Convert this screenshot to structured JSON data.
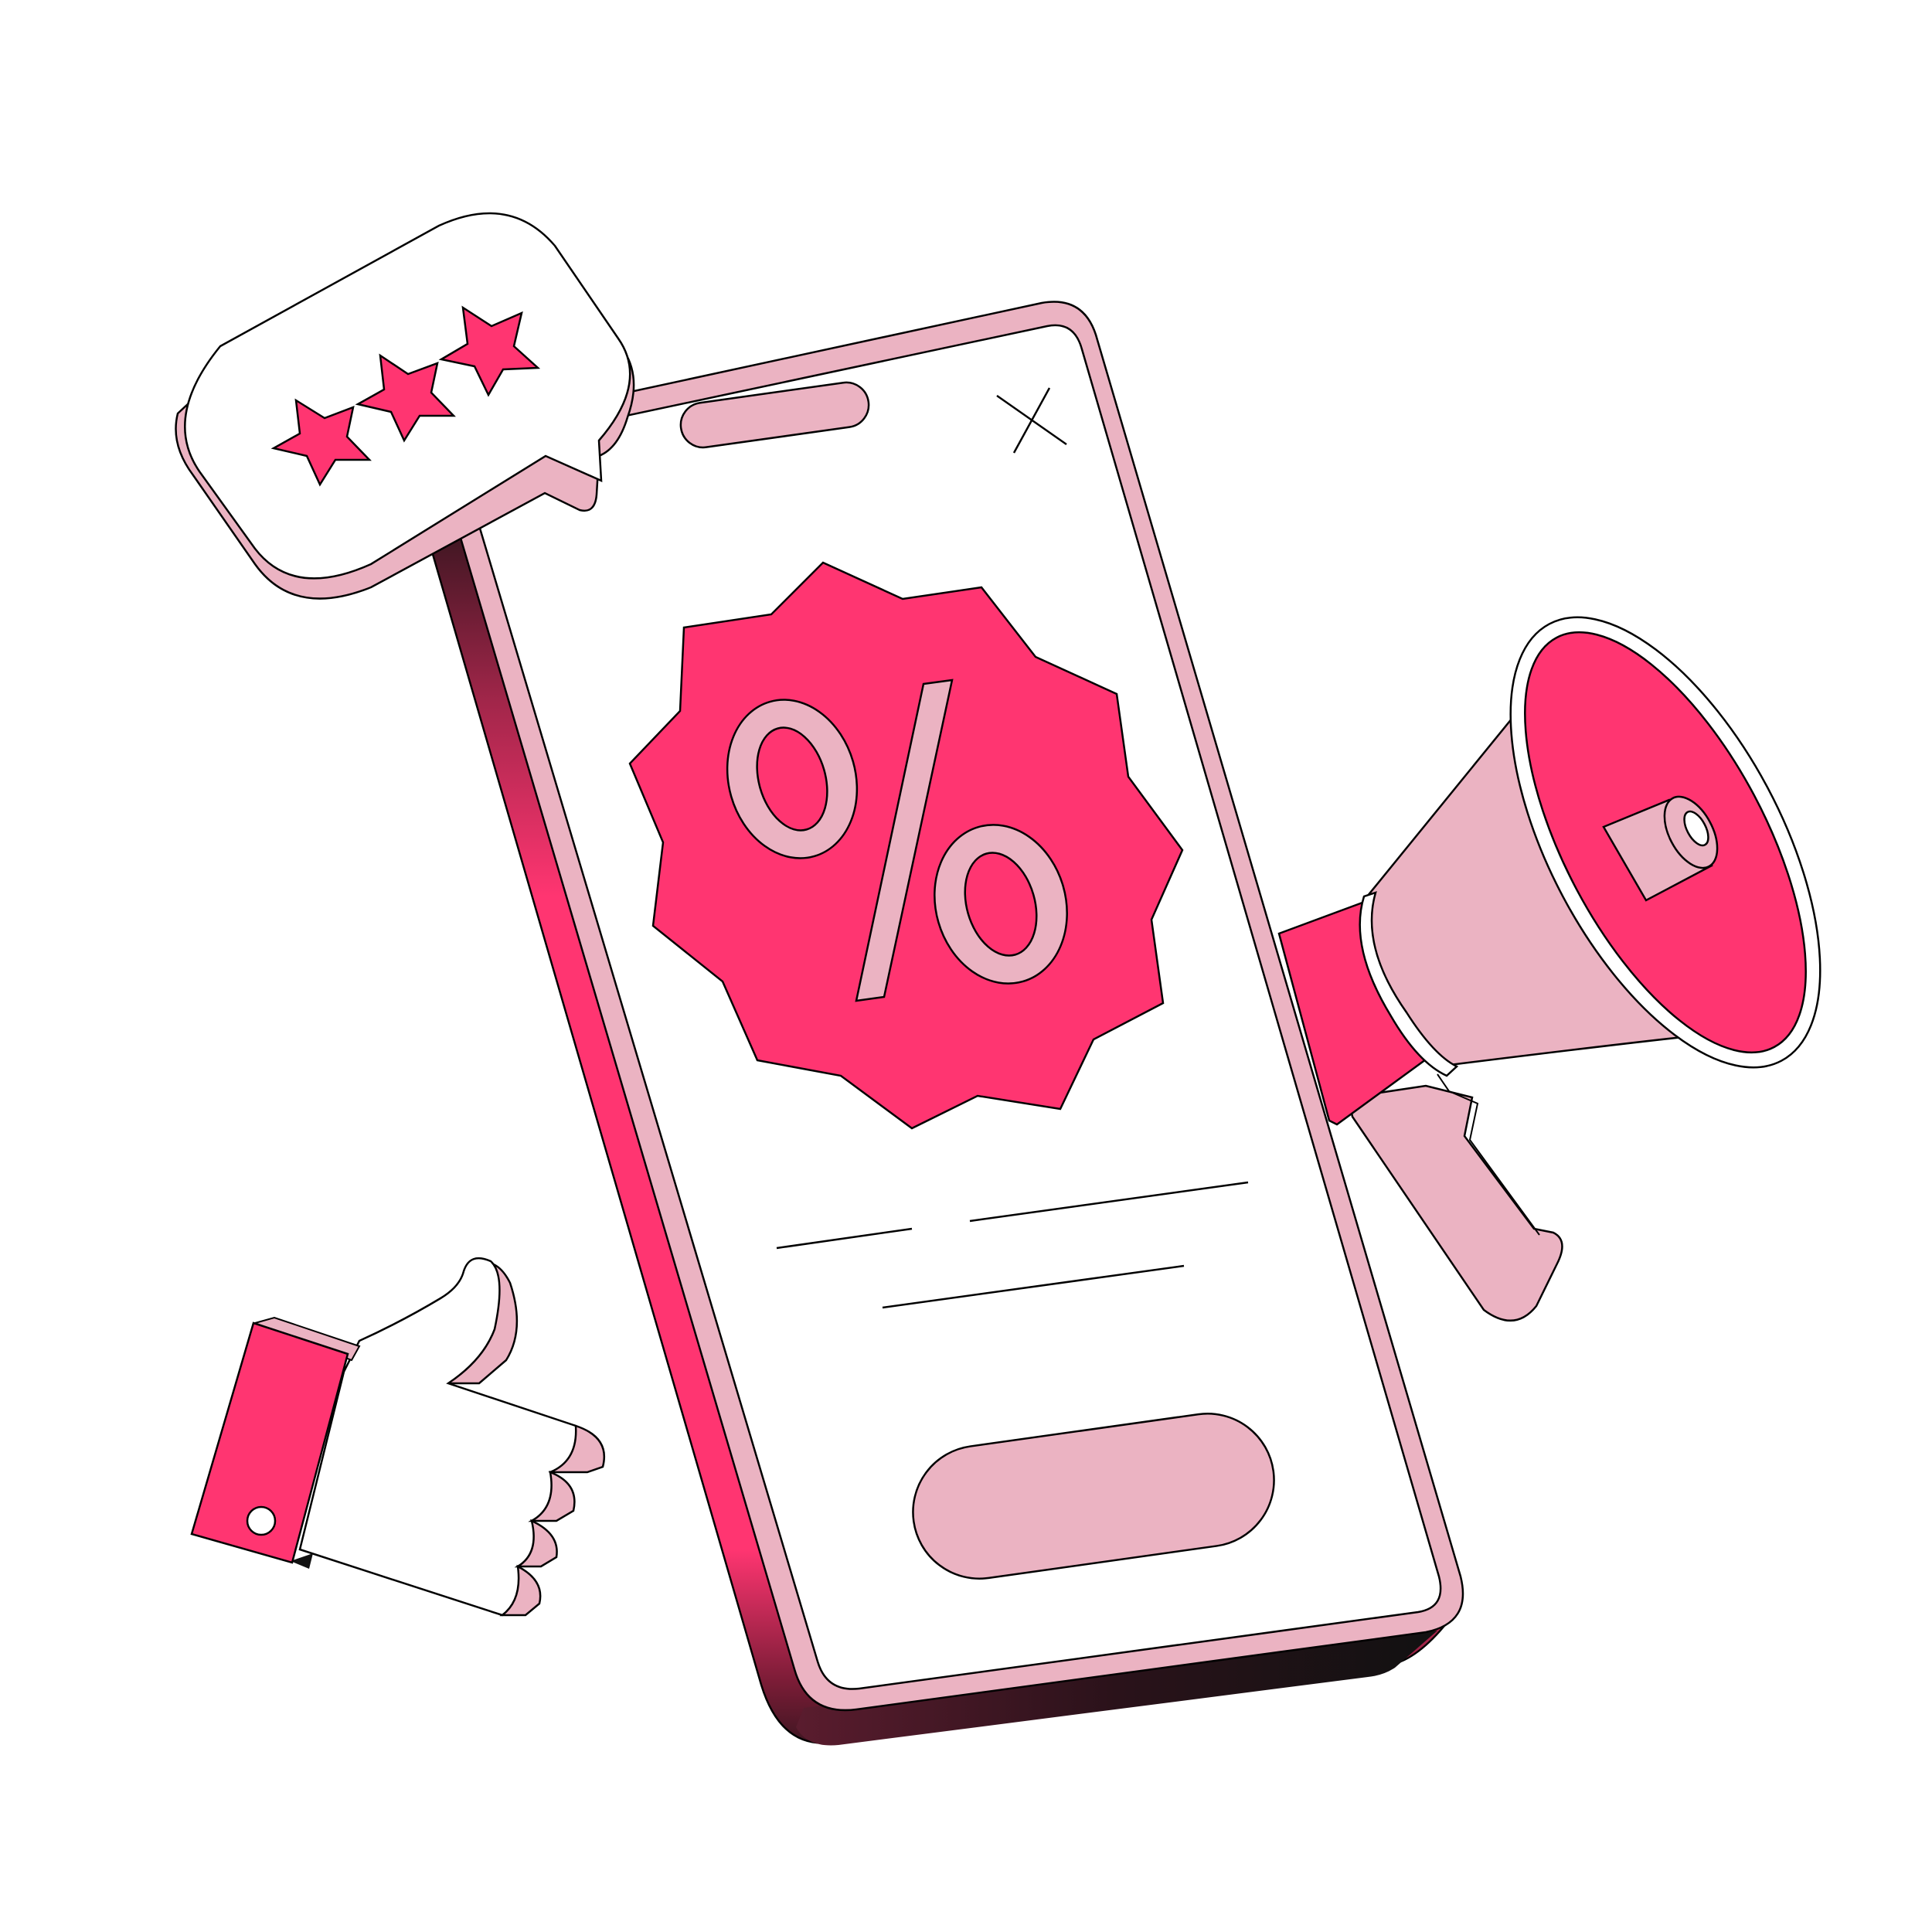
{
  "illustration": {
    "colors": {
      "accent": "#ff3571",
      "soft_pink": "#ebb3c2",
      "outline": "#000000",
      "surface": "#ffffff",
      "shadow_dark": "#4a1a27",
      "shadow_mid": "#a2264a"
    },
    "review_bubble": {
      "rating": 3,
      "max_rating": 3,
      "icon": "star-icon"
    },
    "phone": {
      "close_icon": "close-icon",
      "discount_badge": {
        "icon": "percent-icon",
        "symbol": "%"
      },
      "text_lines": 3,
      "cta_button": {
        "icon": "pill-button"
      }
    },
    "megaphone": {
      "icon": "megaphone-icon"
    },
    "thumbs_up": {
      "icon": "thumbs-up-icon"
    }
  }
}
